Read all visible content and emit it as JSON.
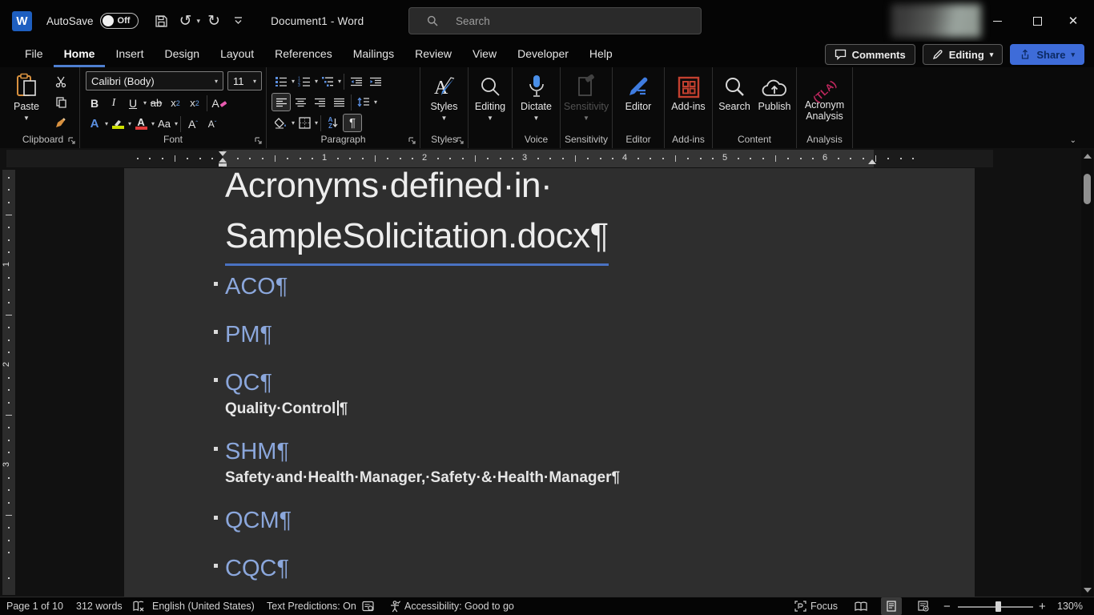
{
  "window": {
    "app_icon": "W",
    "autosave_label": "AutoSave",
    "autosave_state": "Off",
    "title": "Document1 - Word",
    "search_placeholder": "Search"
  },
  "ribbon_tabs": {
    "items": [
      "File",
      "Home",
      "Insert",
      "Design",
      "Layout",
      "References",
      "Mailings",
      "Review",
      "View",
      "Developer",
      "Help"
    ],
    "active": "Home"
  },
  "top_actions": {
    "comments": "Comments",
    "editing": "Editing",
    "share": "Share"
  },
  "ribbon": {
    "clipboard": {
      "paste": "Paste",
      "group": "Clipboard"
    },
    "font": {
      "font_name": "Calibri (Body)",
      "font_size": "11",
      "bold": "B",
      "italic": "I",
      "underline": "U",
      "strike": "ab",
      "sub_base": "x",
      "sub_script": "2",
      "sup_base": "x",
      "sup_script": "2",
      "clear": "A",
      "effects": "A",
      "color": "A",
      "case": "Aa",
      "grow": "A",
      "shrink": "A",
      "group": "Font"
    },
    "paragraph": {
      "sort_a": "A",
      "sort_z": "Z",
      "pilcrow": "¶",
      "group": "Paragraph"
    },
    "styles": {
      "button": "Styles",
      "group": "Styles"
    },
    "editing": {
      "button": "Editing"
    },
    "voice": {
      "button": "Dictate",
      "group": "Voice"
    },
    "sensitivity": {
      "button": "Sensitivity",
      "group": "Sensitivity"
    },
    "editor": {
      "button": "Editor",
      "group": "Editor"
    },
    "addins": {
      "button": "Add-ins",
      "group": "Add-ins"
    },
    "content": {
      "search": "Search",
      "publish": "Publish",
      "group": "Content"
    },
    "analysis": {
      "icon_text": "(TLA)",
      "button": "Acronym Analysis",
      "group": "Analysis"
    }
  },
  "ruler": {
    "h_numbers": [
      "1",
      "2",
      "3",
      "4",
      "5",
      "6"
    ],
    "v_numbers": [
      "1",
      "2",
      "3"
    ]
  },
  "document": {
    "title_line1": "Acronyms·defined·in·",
    "title_line2": "SampleSolicitation.docx¶",
    "pilcrow": "¶",
    "entries": [
      {
        "acronym": "ACO¶",
        "definition": ""
      },
      {
        "acronym": "PM¶",
        "definition": ""
      },
      {
        "acronym": "QC¶",
        "definition": "Quality·Control"
      },
      {
        "acronym": "SHM¶",
        "definition": "Safety·and·Health·Manager,·Safety·&·Health·Manager¶"
      },
      {
        "acronym": "QCM¶",
        "definition": ""
      },
      {
        "acronym": "CQC¶",
        "definition": ""
      }
    ]
  },
  "statusbar": {
    "page": "Page 1 of 10",
    "words": "312 words",
    "language": "English (United States)",
    "predictions": "Text Predictions: On",
    "accessibility": "Accessibility: Good to go",
    "focus": "Focus",
    "zoom_level": "130%"
  },
  "colors": {
    "accent_blue": "#4472c4",
    "heading_blue": "#8ba7dc",
    "share_blue": "#3e6cd9",
    "addins_red": "#c3402f",
    "dictate_blue": "#4a8fe8",
    "editor_blue": "#3f7ce0",
    "tla_pink": "#c0275e",
    "highlight_yellow": "#cde000",
    "font_color_red": "#e03a3a",
    "clear_pink": "#e85bb0",
    "paste_orange": "#d8913f"
  }
}
